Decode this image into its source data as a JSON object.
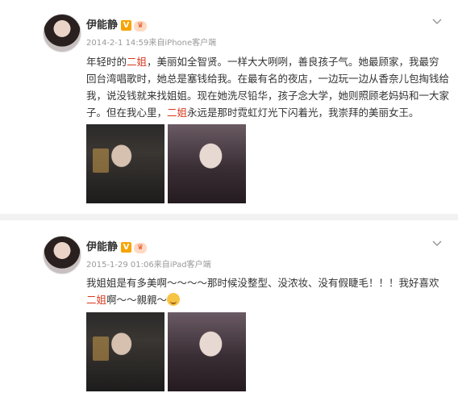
{
  "posts": [
    {
      "username": "伊能静",
      "verified_badge": "V",
      "level_badge": "♛",
      "meta": "2014-2-1 14:59来自iPhone客户端",
      "text_parts": [
        "年轻时的",
        "二姐",
        "，美丽如全智贤。一样大大咧咧，善良孩子气。她最顾家，我最穷回台湾唱歌时，她总是塞钱给我。在最有名的夜店，一边玩一边从香奈儿包掏钱给我，说没钱就来找姐姐。现在她洗尽铅华，孩子念大学，她则照顾老妈妈和一大家子。但在我心里，",
        "二姐",
        "永远是那时霓虹灯光下闪着光，我崇拜的美丽女王。"
      ],
      "images": [
        "photo-1",
        "photo-2"
      ]
    },
    {
      "username": "伊能静",
      "verified_badge": "V",
      "level_badge": "♛",
      "meta": "2015-1-29 01:06来自iPad客户端",
      "text_parts": [
        "我姐姐是有多美啊～～～～那时候没整型、没浓妆、没有假睫毛！！！我好喜欢",
        "二姐",
        "啊～～親親～"
      ],
      "images": [
        "photo-1",
        "photo-2"
      ]
    }
  ],
  "colors": {
    "highlight": "#d9381e",
    "meta": "#999999",
    "vbadge": "#f7a400"
  },
  "icons": {
    "menu": "chevron-down-icon",
    "emoji": "kiss-emoji-icon"
  }
}
